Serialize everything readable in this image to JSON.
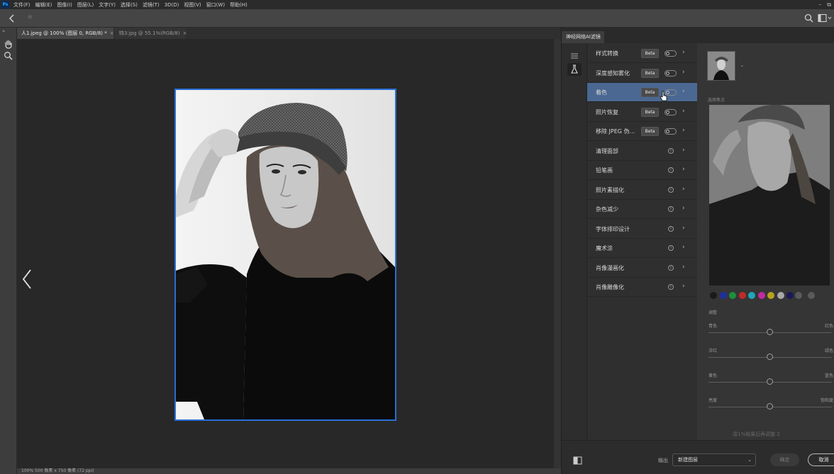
{
  "app": {
    "logo": "Ps"
  },
  "menu": [
    "文件(F)",
    "编辑(E)",
    "图像(I)",
    "图层(L)",
    "文字(Y)",
    "选择(S)",
    "滤镜(T)",
    "3D(D)",
    "视图(V)",
    "窗口(W)",
    "帮助(H)"
  ],
  "window_controls": {
    "minimize": "–",
    "restore": "⧉"
  },
  "options": {
    "tool_glyph": "☼"
  },
  "toolbar": {
    "collapse_glyph": "»"
  },
  "tabs": [
    {
      "label": "人1.jpeg @ 100% (图层 0, RGB/8) *",
      "close": "×"
    },
    {
      "label": "特3.jpg @ 55.1%(RGB/8)",
      "close": "×"
    }
  ],
  "status": {
    "text": "100%   500 像素 x 750 像素 (72 ppi)"
  },
  "panel": {
    "title": "神经网络AI滤镜"
  },
  "filters": [
    {
      "name": "样式转换",
      "beta": "Beta",
      "kind": "toggle",
      "selected": false
    },
    {
      "name": "深度感知雾化",
      "beta": "Beta",
      "kind": "toggle",
      "selected": false
    },
    {
      "name": "着色",
      "beta": "Beta",
      "kind": "toggle",
      "selected": true
    },
    {
      "name": "照片恢复",
      "beta": "Beta",
      "kind": "toggle",
      "selected": false
    },
    {
      "name": "移除 JPEG 伪...",
      "beta": "Beta",
      "kind": "toggle",
      "selected": false
    },
    {
      "name": "清理面部",
      "beta": "",
      "kind": "info",
      "selected": false
    },
    {
      "name": "铅笔画",
      "beta": "",
      "kind": "info",
      "selected": false
    },
    {
      "name": "照片素描化",
      "beta": "",
      "kind": "info",
      "selected": false
    },
    {
      "name": "杂色减少",
      "beta": "",
      "kind": "info",
      "selected": false
    },
    {
      "name": "字体排印设计",
      "beta": "",
      "kind": "info",
      "selected": false
    },
    {
      "name": "魔术涂",
      "beta": "",
      "kind": "info",
      "selected": false
    },
    {
      "name": "肖像漫画化",
      "beta": "",
      "kind": "info",
      "selected": false
    },
    {
      "name": "肖像雕像化",
      "beta": "",
      "kind": "info",
      "selected": false
    }
  ],
  "settings": {
    "ref_dropdown": "⌄",
    "section_label": "选择焦点",
    "swatch_colors": [
      "#1a1a1a",
      "#1f2f9f",
      "#1f8f3f",
      "#c02a2a",
      "#1fa7b8",
      "#c02aa0",
      "#b8a01f",
      "#a8a8a8",
      "#1a1a5a"
    ],
    "add_swatch": "+",
    "remove_swatch": "−",
    "adjust_label": "调整",
    "sliders": [
      {
        "left": "青色",
        "right": "红色",
        "value": 0.5
      },
      {
        "left": "洋红",
        "right": "绿色",
        "value": 0.5
      },
      {
        "left": "黄色",
        "right": "蓝色",
        "value": 0.5
      },
      {
        "left": "亮度",
        "right": "饱和度",
        "value": 0.5
      }
    ],
    "cut_text": "请1%结果后再调整 2"
  },
  "footer": {
    "output_label": "输出",
    "output_value": "新建图层",
    "output_chevron": "⌄",
    "ok": "确定",
    "cancel": "取消"
  }
}
